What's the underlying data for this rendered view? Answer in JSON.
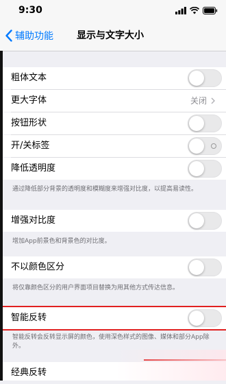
{
  "status_bar": {
    "time": "9:30"
  },
  "nav": {
    "back_label": "辅助功能",
    "title": "显示与文字大小"
  },
  "rows": [
    {
      "label": "粗体文本"
    },
    {
      "label": "更大字体",
      "value": "关闭"
    },
    {
      "label": "按钮形状"
    },
    {
      "label": "开/关标签"
    },
    {
      "label": "降低透明度"
    },
    {
      "label": "增强对比度"
    },
    {
      "label": "不以颜色区分"
    },
    {
      "label": "智能反转"
    },
    {
      "label": "经典反转"
    }
  ],
  "footers": [
    "通过降低部分背景的透明度和模糊度来增强对比度，以提高易读性。",
    "增加App前景色和背景色的对比度。",
    "将仅靠颜色区分的用户界面项目替换为用其他方式传达信息。",
    "智能反转会反转显示屏的颜色，使用深色样式的图像、媒体和部分App除外。"
  ],
  "colors": {
    "accent": "#007aff",
    "highlight": "#e02020"
  }
}
